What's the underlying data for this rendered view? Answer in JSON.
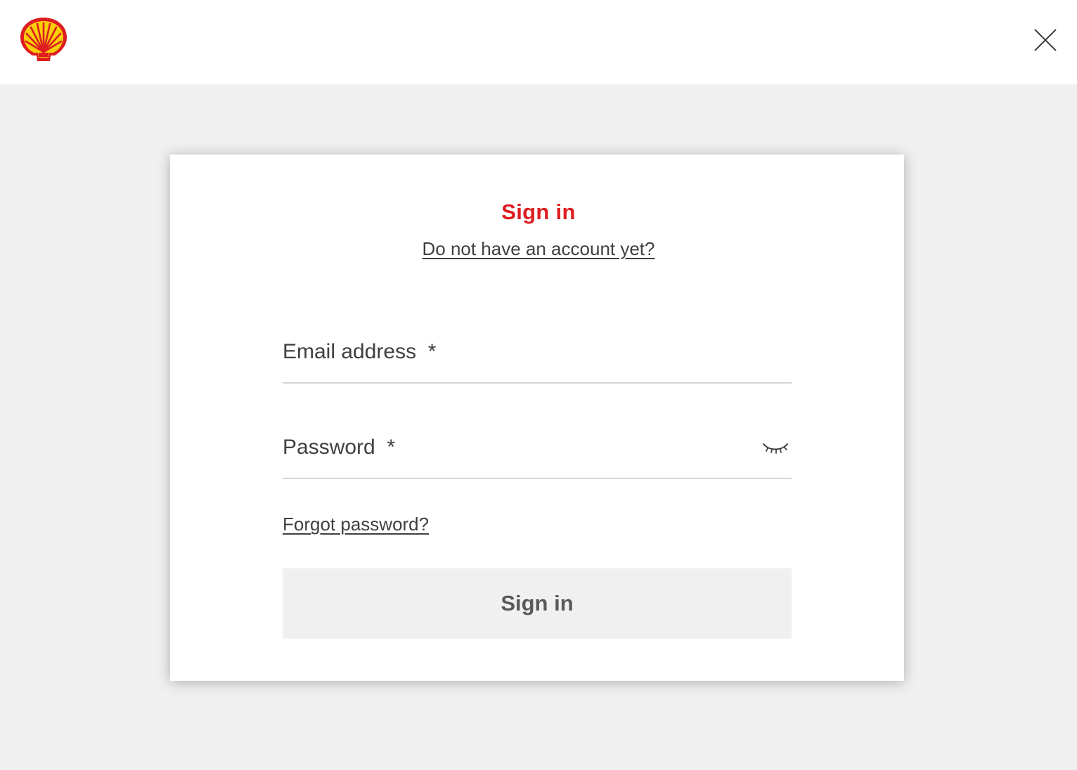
{
  "header": {
    "logo": "shell-pecten-logo",
    "close_icon": "close-icon"
  },
  "signin": {
    "title": "Sign in",
    "register_link": "Do not have an account yet?",
    "email_label": "Email address  *",
    "password_label": "Password  *",
    "password_visibility_icon": "eye-closed-icon",
    "forgot_link": "Forgot password?",
    "submit_label": "Sign in"
  },
  "colors": {
    "brand_red": "#dd1d21",
    "brand_yellow": "#fbce07",
    "page_background": "#f0f0f0",
    "text": "#404040",
    "button_background": "#f0f0f0",
    "button_text": "#595959"
  }
}
